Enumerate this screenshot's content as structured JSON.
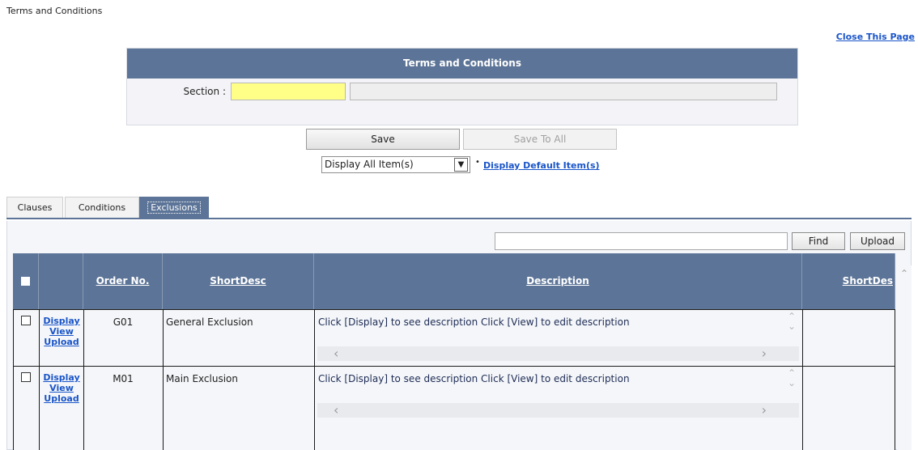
{
  "page": {
    "title": "Terms and Conditions",
    "close_link": "Close This Page"
  },
  "form": {
    "header": "Terms and Conditions",
    "section_label": "Section :",
    "section_code_value": "",
    "section_desc_value": ""
  },
  "actions": {
    "save": "Save",
    "save_to_all": "Save To All",
    "display_selected": "Display All Item(s)",
    "bullet": "•",
    "default_link": "Display Default Item(s)"
  },
  "tabs": [
    {
      "label": "Clauses",
      "active": false
    },
    {
      "label": "Conditions",
      "active": false
    },
    {
      "label": "Exclusions",
      "active": true
    }
  ],
  "toolbar": {
    "find_value": "",
    "find": "Find",
    "upload": "Upload"
  },
  "grid": {
    "columns": [
      "",
      "",
      "Order No.",
      "ShortDesc",
      "Description",
      "ShortDes"
    ],
    "rows": [
      {
        "actions": [
          "Display",
          "View",
          "Upload"
        ],
        "order": "G01",
        "short_desc": "General Exclusion",
        "description": "Click [Display] to see description Click [View] to edit description"
      },
      {
        "actions": [
          "Display",
          "View",
          "Upload"
        ],
        "order": "M01",
        "short_desc": "Main Exclusion",
        "description": "Click [Display] to see description Click [View] to edit description"
      }
    ]
  },
  "colors": {
    "header_bg": "#5c7497",
    "link": "#1a55c8",
    "section_code_bg": "#ffff88"
  },
  "icons": {
    "select_arrow": "chevron-down-icon",
    "scroll_up": "chevron-up-icon",
    "scroll_down": "chevron-down-icon",
    "scroll_left": "chevron-left-icon",
    "scroll_right": "chevron-right-icon"
  }
}
